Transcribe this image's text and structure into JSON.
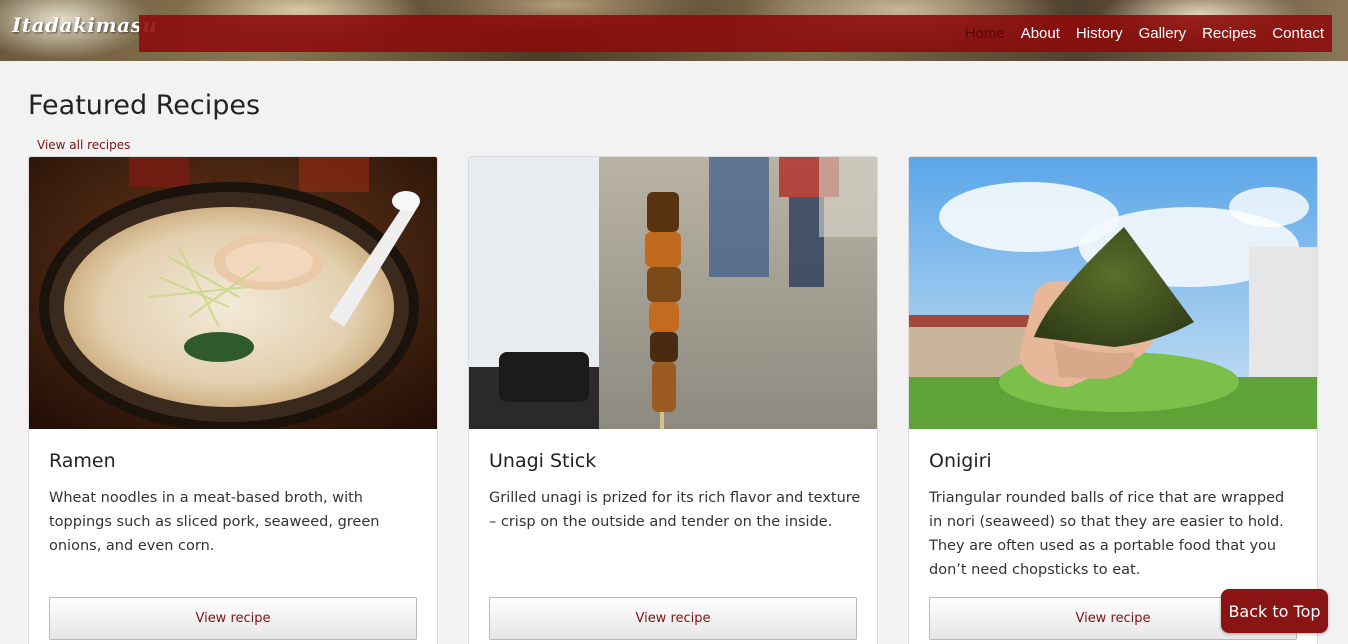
{
  "header": {
    "logo_text": "Itadakimasu",
    "nav": [
      {
        "label": "Home",
        "active": true
      },
      {
        "label": "About",
        "active": false
      },
      {
        "label": "History",
        "active": false
      },
      {
        "label": "Gallery",
        "active": false
      },
      {
        "label": "Recipes",
        "active": false
      },
      {
        "label": "Contact",
        "active": false
      }
    ],
    "nav_color": "#8c0a0a"
  },
  "main": {
    "title": "Featured Recipes",
    "view_all_label": "View all recipes",
    "cards": [
      {
        "title": "Ramen",
        "description": "Wheat noodles in a meat-based broth, with toppings such as sliced pork, seaweed, green onions, and even corn.",
        "button_label": "View recipe",
        "image": "ramen-bowl-photo"
      },
      {
        "title": "Unagi Stick",
        "description": "Grilled unagi is prized for its rich flavor and texture – crisp on the outside and tender on the inside.",
        "button_label": "View recipe",
        "image": "grilled-eel-skewer-photo"
      },
      {
        "title": "Onigiri",
        "description": "Triangular rounded balls of rice that are wrapped in nori (seaweed) so that they are easier to hold. They are often used as a portable food that you don’t need chopsticks to eat.",
        "button_label": "View recipe",
        "image": "onigiri-in-hand-photo"
      }
    ]
  },
  "back_to_top_label": "Back to Top",
  "colors": {
    "accent": "#8a1414",
    "link": "#7a1414",
    "background": "#f2f2f2"
  }
}
